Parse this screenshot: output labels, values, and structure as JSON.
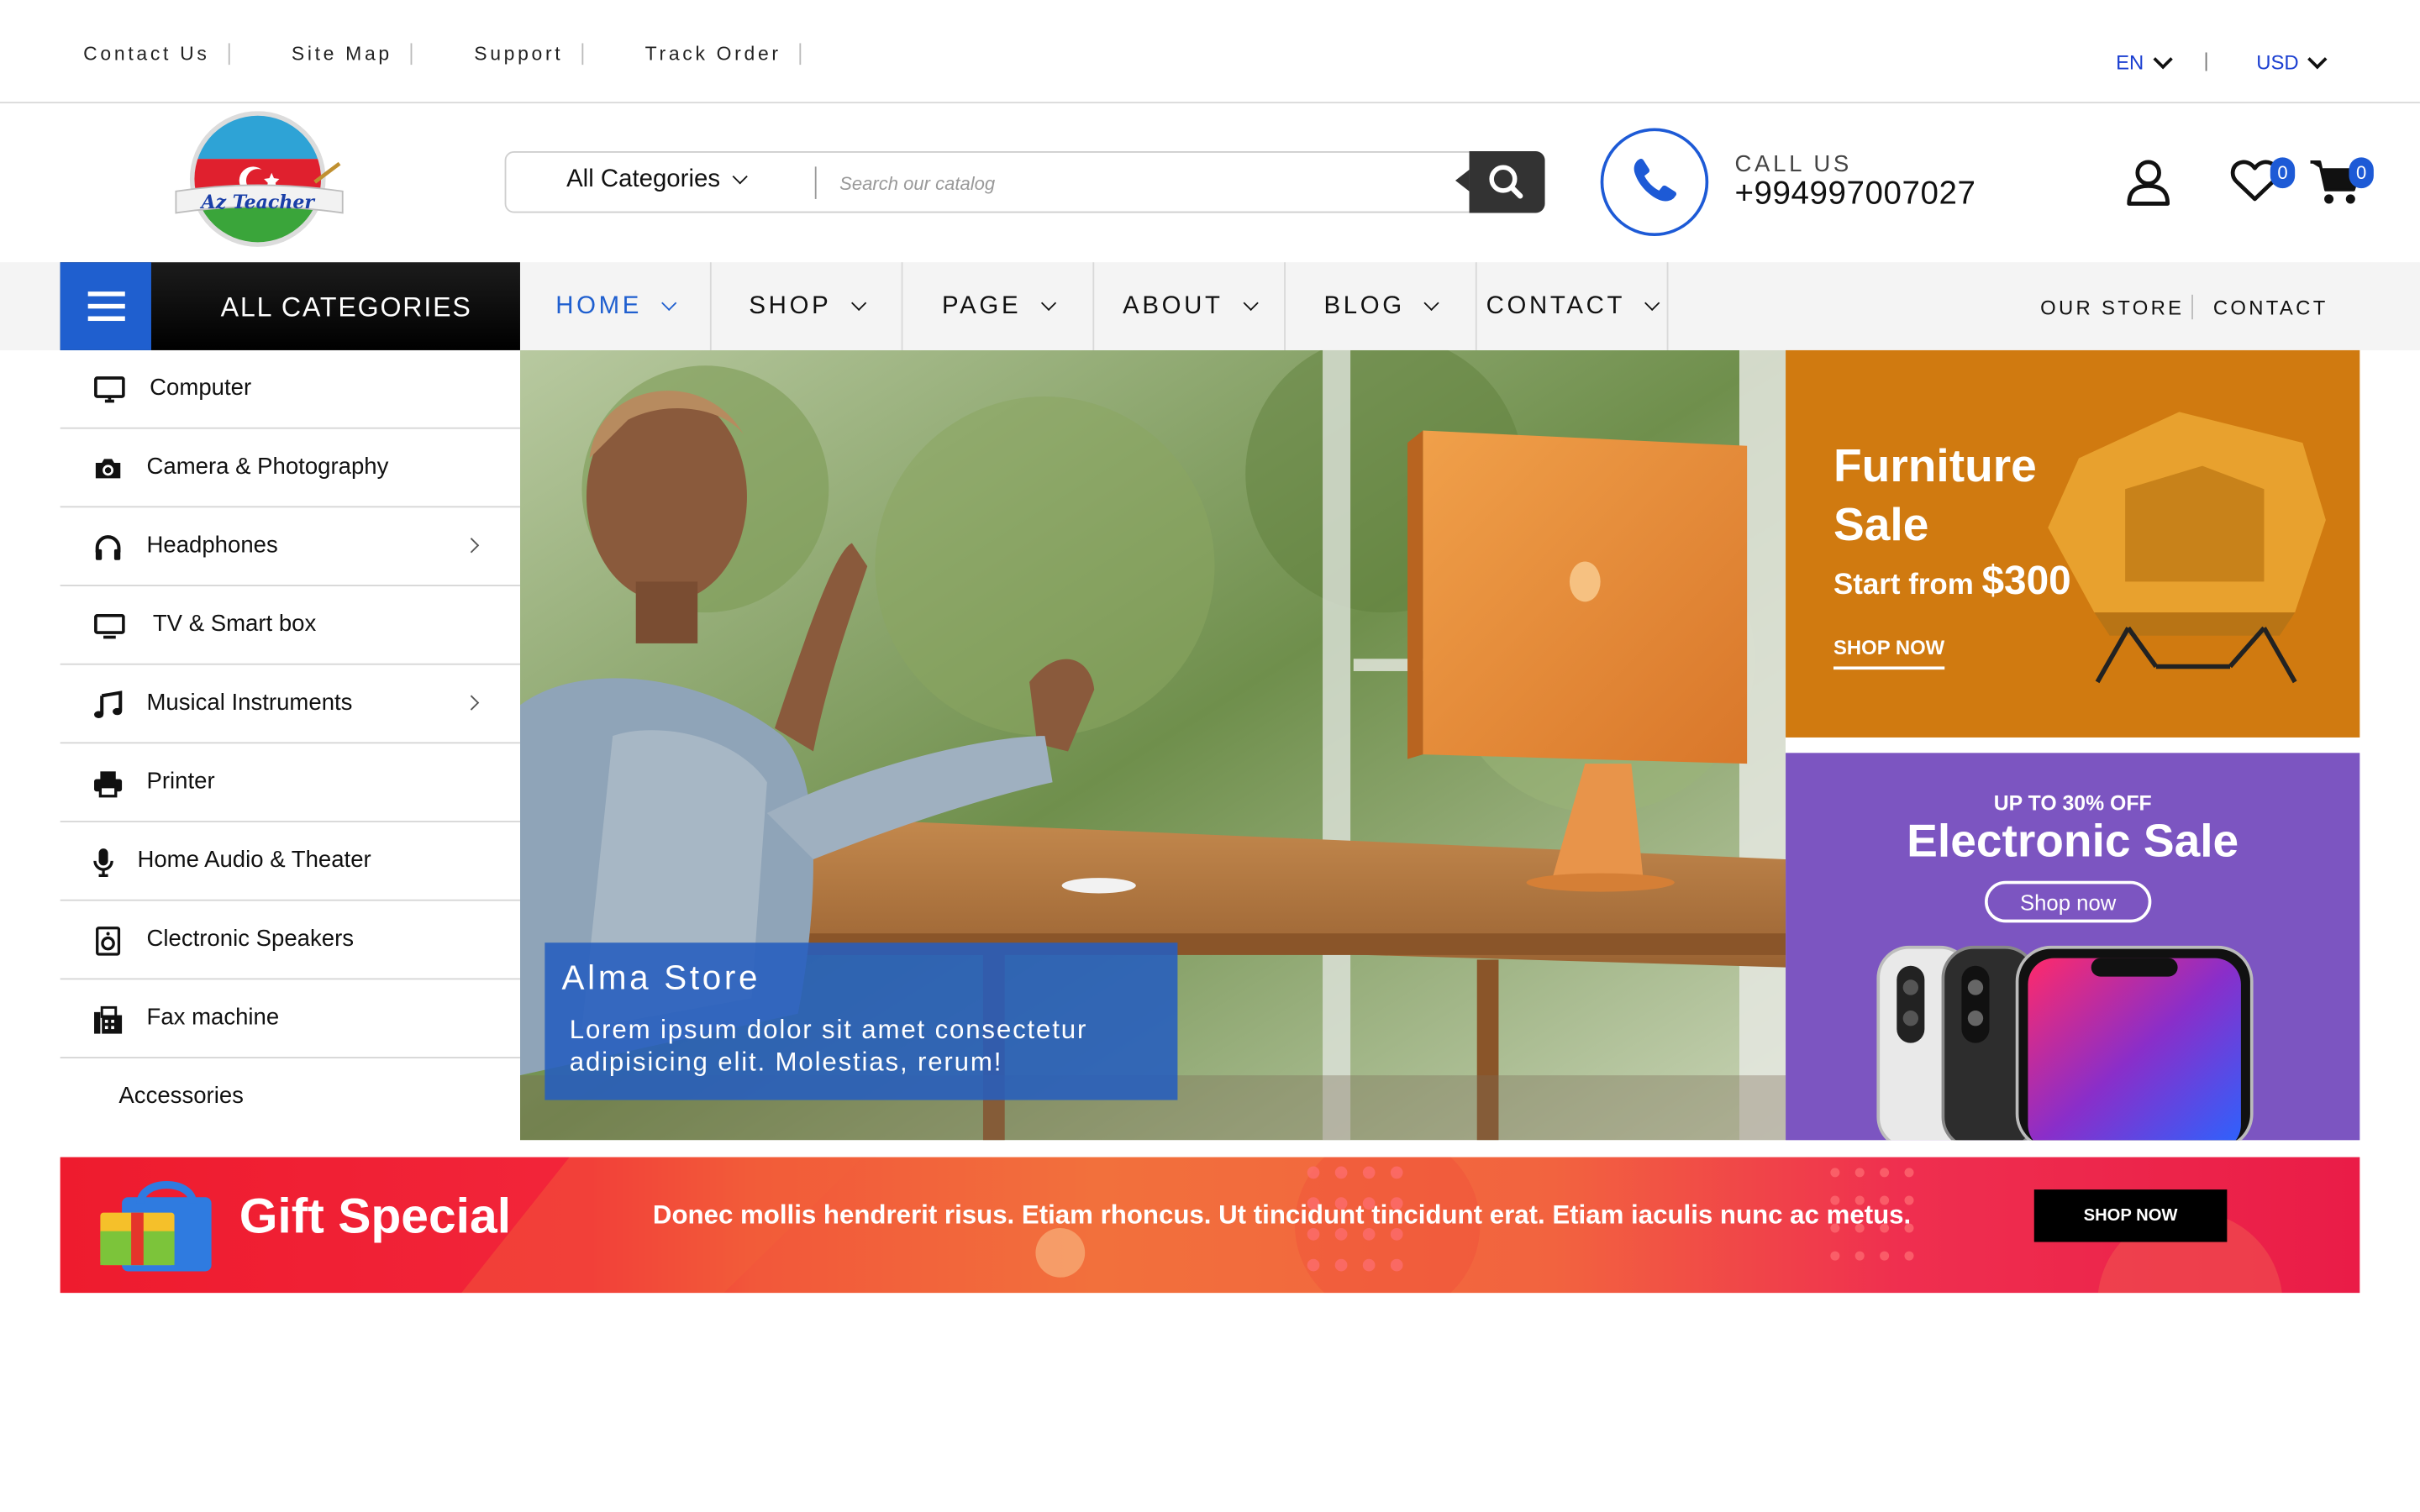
{
  "topbar": {
    "links": [
      "Contact Us",
      "Site Map",
      "Support",
      "Track Order"
    ],
    "language": "EN",
    "currency": "USD"
  },
  "header": {
    "logo_text": "Az Teacher",
    "search": {
      "category": "All Categories",
      "placeholder": "Search our catalog"
    },
    "call_label": "CALL US",
    "phone": "+994997007027",
    "wishlist_count": "0",
    "cart_count": "0"
  },
  "nav": {
    "all_categories": "ALL CATEGORIES",
    "items": [
      "HOME",
      "SHOP",
      "PAGE",
      "ABOUT",
      "BLOG",
      "CONTACT"
    ],
    "active": "HOME",
    "right_links": [
      "OUR STORE",
      "CONTACT"
    ]
  },
  "sidebar": {
    "items": [
      {
        "label": "Computer",
        "icon": "monitor-icon"
      },
      {
        "label": "Camera & Photography",
        "icon": "camera-icon"
      },
      {
        "label": "Headphones",
        "icon": "headphones-icon",
        "submenu": true
      },
      {
        "label": "TV & Smart box",
        "icon": "tv-icon"
      },
      {
        "label": "Musical Instruments",
        "icon": "music-note-icon",
        "submenu": true
      },
      {
        "label": "Printer",
        "icon": "printer-icon"
      },
      {
        "label": "Home Audio & Theater",
        "icon": "microphone-icon"
      },
      {
        "label": "Clectronic Speakers",
        "icon": "speaker-icon"
      },
      {
        "label": "Fax machine",
        "icon": "fax-icon"
      },
      {
        "label": "Accessories",
        "icon": ""
      }
    ]
  },
  "hero": {
    "title": "Alma Store",
    "text": "Lorem ipsum dolor sit amet consectetur adipisicing elit. Molestias, rerum!"
  },
  "promos": {
    "furniture": {
      "title_line1": "Furniture",
      "title_line2": "Sale",
      "subtitle": "Start from",
      "price": "$300",
      "cta": "SHOP NOW"
    },
    "electronic": {
      "kicker": "UP TO 30% OFF",
      "title": "Electronic Sale",
      "cta": "Shop now"
    },
    "gift": {
      "title": "Gift Special",
      "text": "Donec mollis hendrerit risus. Etiam rhoncus. Ut tincidunt tincidunt erat. Etiam iaculis nunc ac metus.",
      "cta": "SHOP NOW"
    }
  },
  "colors": {
    "accent": "#1f5fcf",
    "furniture_bg": "#d07a10",
    "electronic_bg": "#7c55c1",
    "gift_bg": "#ee1b2e"
  }
}
